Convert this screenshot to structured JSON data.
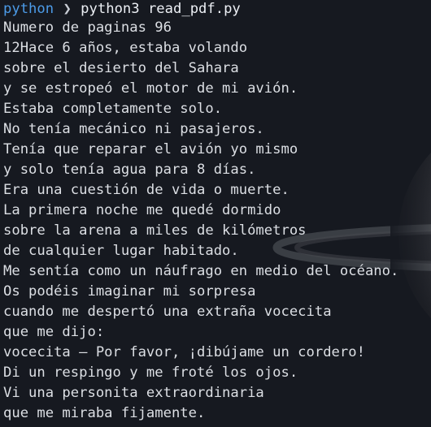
{
  "terminal": {
    "prompt": {
      "directory": "python",
      "arrow": "❯",
      "command": "python3 read_pdf.py"
    },
    "output_lines": [
      "Numero de paginas 96",
      "12Hace 6 años, estaba volando",
      "sobre el desierto del Sahara",
      "y se estropeó el motor de mi avión.",
      "Estaba completamente solo.",
      "No tenía mecánico ni pasajeros.",
      "Tenía que reparar el avión yo mismo",
      "y solo tenía agua para 8 días.",
      "Era una cuestión de vida o muerte.",
      "La primera noche me quedé dormido",
      "sobre la arena a miles de kilómetros",
      "de cualquier lugar habitado.",
      "Me sentía como un náufrago en medio del océano.",
      "Os podéis imaginar mi sorpresa",
      "cuando me despertó una extraña vocecita",
      "que me dijo:",
      "vocecita — Por favor, ¡dibújame un cordero!",
      "Di un respingo y me froté los ojos.",
      "Vi una personita extraordinaria",
      "que me miraba fijamente."
    ]
  },
  "colors": {
    "background": "#161920",
    "text": "#dcdfe4",
    "prompt_directory": "#4c9be8"
  },
  "background_image": "saturn-wallpaper"
}
